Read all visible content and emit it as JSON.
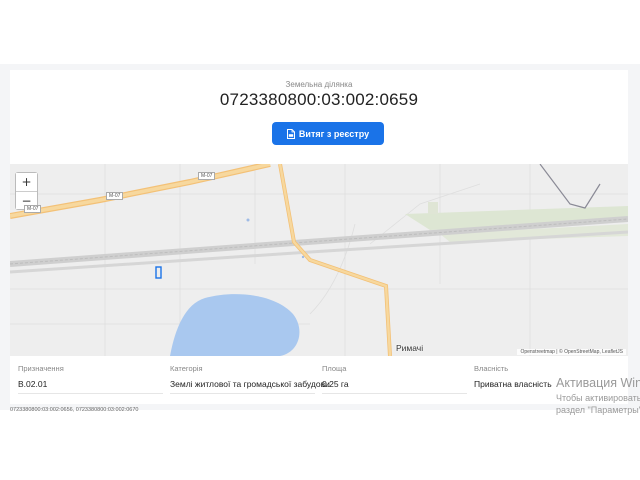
{
  "parcel": {
    "subtitle": "Земельна ділянка",
    "cadastral_number": "0723380800:03:002:0659",
    "extract_button_label": "Витяг з реєстру",
    "extract_button_icon": "document-icon"
  },
  "map": {
    "zoom_in": "+",
    "zoom_out": "−",
    "place_label": "Римачі",
    "road_labels": [
      "M-07",
      "M-07",
      "M-07"
    ],
    "attribution": "Openstreetmap | © OpenStreetMap, LeafletJS",
    "colors": {
      "land": "#eeeeee",
      "water": "#a9c8ef",
      "road_major": "#f7d08a",
      "rail": "#bbbbbb",
      "parcel_outline": "#1a73e8"
    }
  },
  "info": {
    "purpose": {
      "label": "Призначення",
      "value": "В.02.01"
    },
    "category": {
      "label": "Категорія",
      "value": "Землі житлової та громадської забудови"
    },
    "area": {
      "label": "Площа",
      "value": "0.25 га"
    },
    "ownership": {
      "label": "Власність",
      "value": "Приватна власність"
    }
  },
  "footer": {
    "related_ids": "0723380800:03:002:0656, 0723380800:03:002:0670"
  },
  "windows_watermark": {
    "line1": "Активация Windows",
    "line2": "Чтобы активировать Windows, перейдите в",
    "line3": "раздел \"Параметры\"."
  }
}
